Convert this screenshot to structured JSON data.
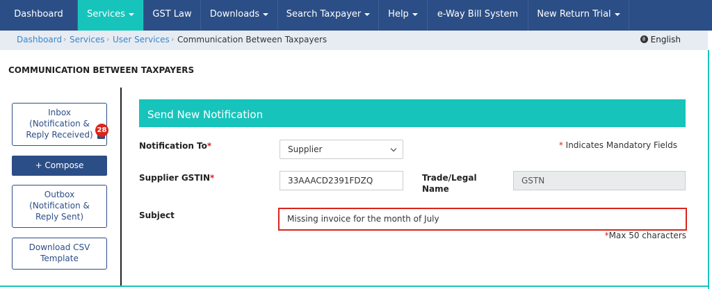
{
  "nav": {
    "items": [
      {
        "label": "Dashboard",
        "dropdown": false
      },
      {
        "label": "Services",
        "dropdown": true,
        "active": true
      },
      {
        "label": "GST Law",
        "dropdown": false
      },
      {
        "label": "Downloads",
        "dropdown": true
      },
      {
        "label": "Search Taxpayer",
        "dropdown": true
      },
      {
        "label": "Help",
        "dropdown": true
      },
      {
        "label": "e-Way Bill System",
        "dropdown": false
      },
      {
        "label": "New Return Trial",
        "dropdown": true
      }
    ]
  },
  "breadcrumb": {
    "items": [
      "Dashboard",
      "Services",
      "User Services",
      "Communication Between Taxpayers"
    ],
    "separator": "›"
  },
  "language": "English",
  "page_title": "COMMUNICATION BETWEEN TAXPAYERS",
  "sidebar": {
    "inbox": {
      "line1": "Inbox",
      "line2": "(Notification &",
      "line3": "Reply Received)",
      "badge": "28"
    },
    "compose": "+ Compose",
    "outbox": {
      "line1": "Outbox",
      "line2": "(Notification &",
      "line3": "Reply Sent)"
    },
    "download": {
      "line1": "Download CSV",
      "line2": "Template"
    }
  },
  "form": {
    "header": "Send New Notification",
    "mandatory_mark": "*",
    "mandatory_note": " Indicates Mandatory Fields",
    "notification_to": {
      "label": "Notification To",
      "required": "*",
      "value": "Supplier"
    },
    "supplier_gstin": {
      "label": "Supplier GSTIN",
      "required": "*",
      "value": "33AAACD2391FDZQ"
    },
    "trade_name": {
      "label_line1": "Trade/Legal",
      "label_line2": "Name",
      "value": "GSTN"
    },
    "subject": {
      "label": "Subject",
      "value": "Missing invoice for the month of July"
    },
    "max_mark": "*",
    "max_note": "Max 50 characters"
  },
  "colors": {
    "navbar": "#2c4e86",
    "accent": "#17c4bb",
    "required": "#d9251c",
    "link": "#3a87c8"
  }
}
